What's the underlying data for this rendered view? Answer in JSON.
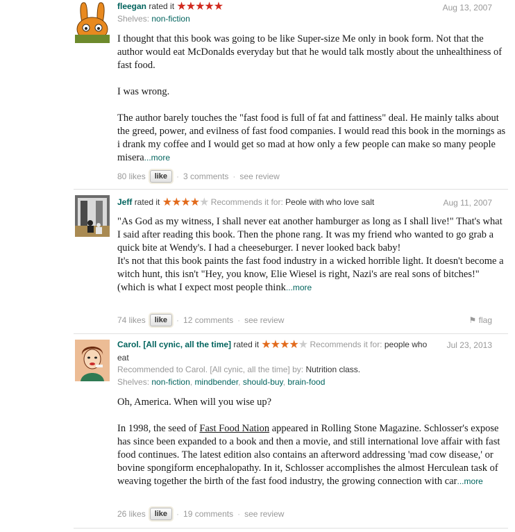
{
  "reviews": [
    {
      "username": "fleegan",
      "rated_text": "rated it",
      "rating": 5,
      "date": "Aug 13, 2007",
      "shelves_label": "Shelves:",
      "shelves": "non-fiction",
      "body": [
        "I thought that this book was going to be like Super-size Me only in book form. Not that the author would eat McDonalds everyday but that he would talk mostly about the unhealthiness of fast food.",
        "I was wrong.",
        "The author barely touches the \"fast food is full of fat and fattiness\" deal. He mainly talks about the greed, power, and evilness of fast food companies. I would read this book in the mornings as i drank my coffee and I would get so mad at how only a few people can make so many people misera"
      ],
      "more_label": "...more",
      "likes": "80 likes",
      "like_button": "like",
      "comments": "3 comments",
      "see_review": "see review"
    },
    {
      "username": "Jeff",
      "rated_text": "rated it",
      "rating": 4,
      "recommends_label": "Recommends it for:",
      "recommends": "Peole with who love salt",
      "date": "Aug 11, 2007",
      "body_lines": [
        "\"As God as my witness, I shall never eat another hamburger as long as I shall live!\" That's what I said after reading this book. Then the phone rang. It was my friend who wanted to go grab a quick bite at Wendy's. I had a cheeseburger. I never looked back baby!",
        "It's not that this book paints the fast food industry in a wicked horrible light. It doesn't become a witch hunt, this isn't \"Hey, you know, Elie Wiesel is right, Nazi's are real sons of bitches!\" (which is what I expect most people think"
      ],
      "more_label": "...more",
      "likes": "74 likes",
      "like_button": "like",
      "comments": "12 comments",
      "see_review": "see review",
      "flag": "flag"
    },
    {
      "username": "Carol. [All cynic, all the time]",
      "rated_text": "rated it",
      "rating": 4,
      "recommends_label": "Recommends it for:",
      "recommends": "people who eat",
      "date": "Jul 23, 2013",
      "recommended_to_label": "Recommended to Carol. [All cynic, all the time] by:",
      "recommended_to": "Nutrition class.",
      "shelves_label": "Shelves:",
      "shelves": [
        "non-fiction",
        "mindbender",
        "should-buy",
        "brain-food"
      ],
      "body_first": "Oh, America. When will you wise up?",
      "body_second_pre": "In 1998, the seed of ",
      "book_link": "Fast Food Nation",
      "body_second_post": " appeared in Rolling Stone Magazine. Schlosser's expose has since been expanded to a book and then a movie, and still international love affair with fast food continues. The latest edition also contains an afterword addressing 'mad cow disease,' or bovine spongiform encephalopathy. In it, Schlosser accomplishes the almost Herculean task of weaving together the birth of the fast food industry, the growing connection with car",
      "more_label": "...more",
      "likes": "26 likes",
      "like_button": "like",
      "comments": "19 comments",
      "see_review": "see review"
    }
  ],
  "colors": {
    "link": "#00635d",
    "star_on_review1": "#d12a1f",
    "star_on": "#e26b1d",
    "star_off": "#cccccc",
    "muted": "#999999"
  },
  "icons": [
    "flag-icon"
  ]
}
